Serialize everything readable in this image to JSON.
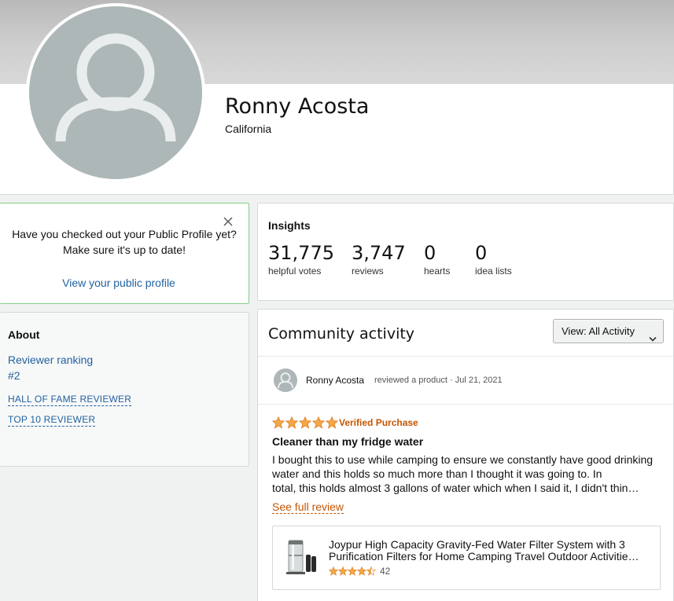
{
  "profile": {
    "name": "Ronny Acosta",
    "location": "California"
  },
  "notice": {
    "text": "Have you checked out your Public Profile yet? Make sure it's up to date!",
    "link": "View your public profile"
  },
  "about": {
    "title": "About",
    "ranking_label": "Reviewer ranking",
    "ranking_value": "#2",
    "badges": [
      "HALL OF FAME REVIEWER",
      "TOP 10 REVIEWER"
    ]
  },
  "insights": {
    "title": "Insights",
    "stats": [
      {
        "value": "31,775",
        "label": "helpful votes"
      },
      {
        "value": "3,747",
        "label": "reviews"
      },
      {
        "value": "0",
        "label": "hearts"
      },
      {
        "value": "0",
        "label": "idea lists"
      }
    ]
  },
  "community": {
    "title": "Community activity",
    "view_label": "View:",
    "view_value": "All Activity",
    "activity": {
      "user": "Ronny Acosta",
      "meta": "reviewed a product · Jul 21, 2021",
      "rating": 5,
      "verified": "Verified Purchase",
      "title": "Cleaner than my fridge water",
      "body_main": "I bought this to use while camping to ensure we constantly have good drinking water and this holds so much more than I thought it was going to. In",
      "body_last": "total, this holds almost 3 gallons of water which when I said it, I didn't thin…",
      "see_full": "See full review",
      "product": {
        "title_line1": "Joypur High Capacity Gravity-Fed Water Filter System with 3",
        "title_line2": "Purification Filters for Home Camping Travel Outdoor Activitie…",
        "rating": 4.5,
        "rating_count": "42"
      }
    }
  },
  "colors": {
    "link": "#2162a1",
    "accent_orange": "#c45500",
    "star": "#f3a847",
    "notice_border": "#7fcf88"
  }
}
